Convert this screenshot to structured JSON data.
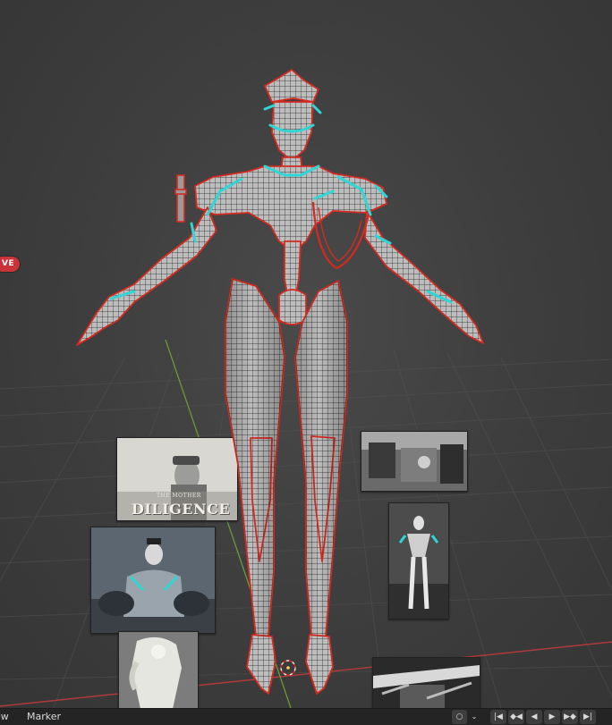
{
  "viewport": {
    "live_badge": "VE",
    "reference_images": [
      {
        "name": "diligence-title-card",
        "caption": "DILIGENCE",
        "small_caption": "THE MOTHER"
      },
      {
        "name": "reference-shot-carriage"
      },
      {
        "name": "reference-shot-group"
      },
      {
        "name": "reference-shot-full-body"
      },
      {
        "name": "reference-shot-statue"
      },
      {
        "name": "reference-shot-interior"
      }
    ]
  },
  "timeline_footer": {
    "menu": [
      "ew",
      "Marker"
    ],
    "controls": {
      "keying": "○",
      "dropdown": "⌄",
      "jump_start": "|◀",
      "prev_keyframe": "◆◀",
      "play_reverse": "◀",
      "play": "▶",
      "next_keyframe": "▶◆",
      "jump_end": "▶|"
    }
  },
  "colors": {
    "mesh_body": "#b9b9b9",
    "wire": "#202020",
    "seam_red": "#d42a20",
    "accent_cyan": "#2fd6d6",
    "x_axis": "#b03a3a",
    "y_axis": "#6fa03a"
  }
}
